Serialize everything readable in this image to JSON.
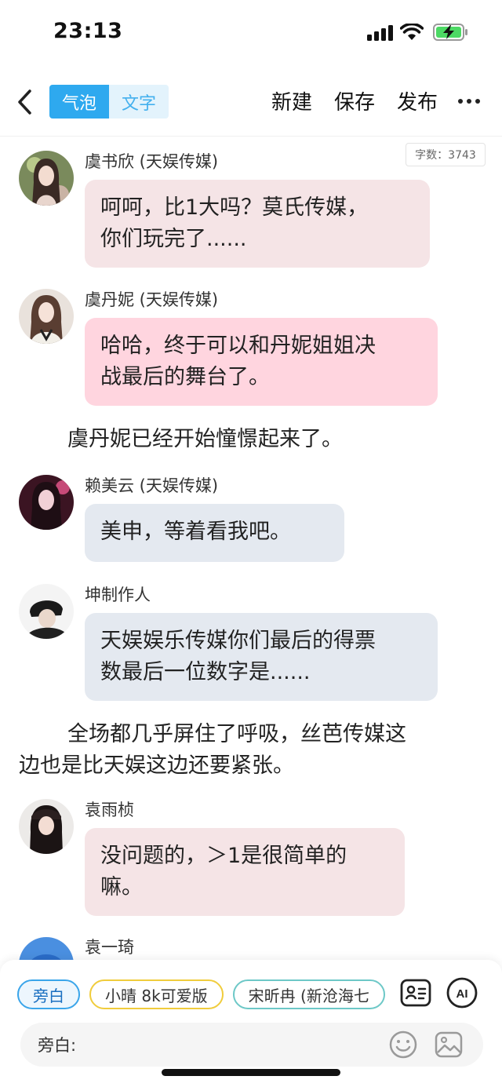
{
  "status": {
    "time": "23:13"
  },
  "nav": {
    "tab_bubble": "气泡",
    "tab_text": "文字",
    "new_label": "新建",
    "save_label": "保存",
    "publish_label": "发布"
  },
  "word_count": "字数：3743",
  "messages": [
    {
      "name": "虞书欣 (天娱传媒)",
      "text": [
        "呵呵，比1大吗？莫氏传媒，",
        "你们玩完了......"
      ]
    },
    {
      "name": "虞丹妮 (天娱传媒)",
      "text": [
        "哈哈，终于可以和丹妮姐姐决",
        "战最后的舞台了。"
      ]
    },
    {
      "name": "赖美云 (天娱传媒)",
      "text": [
        "美申，等着看我吧。"
      ]
    },
    {
      "name": "坤制作人",
      "text": [
        "天娱娱乐传媒你们最后的得票",
        "数最后一位数字是......"
      ]
    },
    {
      "name": "袁雨桢",
      "text": [
        "没问题的，＞1是很简单的",
        "嘛。"
      ]
    },
    {
      "name": "袁一琦"
    }
  ],
  "narrations": [
    {
      "lines": [
        "虞丹妮已经开始憧憬起来了。"
      ]
    },
    {
      "lines": [
        "全场都几乎屏住了呼吸，丝芭传媒这",
        "边也是比天娱这边还要紧张。"
      ]
    }
  ],
  "composer": {
    "chips": [
      "旁白",
      "小晴 8k可爱版",
      "宋昕冉 (新沧海七"
    ],
    "input_label": "旁白:"
  }
}
